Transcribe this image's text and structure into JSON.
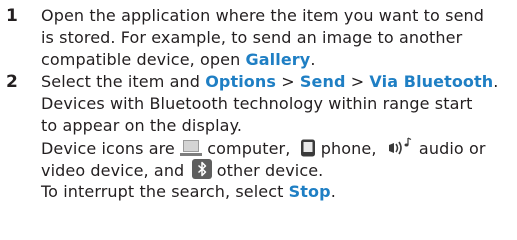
{
  "steps": [
    {
      "number": "1",
      "line1": "Open the application where the item you want to send",
      "line2": "is stored. For example, to send an image to another",
      "line3_prefix": "compatible device, open ",
      "line3_link": "Gallery",
      "line3_suffix": "."
    },
    {
      "number": "2",
      "select_prefix": "Select the item and ",
      "options": "Options",
      "sep": " > ",
      "send": "Send",
      "via_bluetooth": "Via Bluetooth",
      "period": ".",
      "line2": "Devices with Bluetooth technology within range start",
      "line3": "to appear on the display.",
      "icons_prefix": "Device icons are ",
      "computer_text": " computer,",
      "phone_text": " phone,",
      "audio_text": " audio or",
      "video_text": "video device, and ",
      "other_text": " other device.",
      "interrupt_prefix": "To interrupt the search, select ",
      "stop": "Stop",
      "interrupt_suffix": "."
    }
  ],
  "icons": {
    "computer": "computer-icon",
    "phone": "phone-icon",
    "audio": "audio-device-icon",
    "other": "bluetooth-icon"
  },
  "colors": {
    "text": "#231f20",
    "ui_link": "#1f7fc4"
  }
}
